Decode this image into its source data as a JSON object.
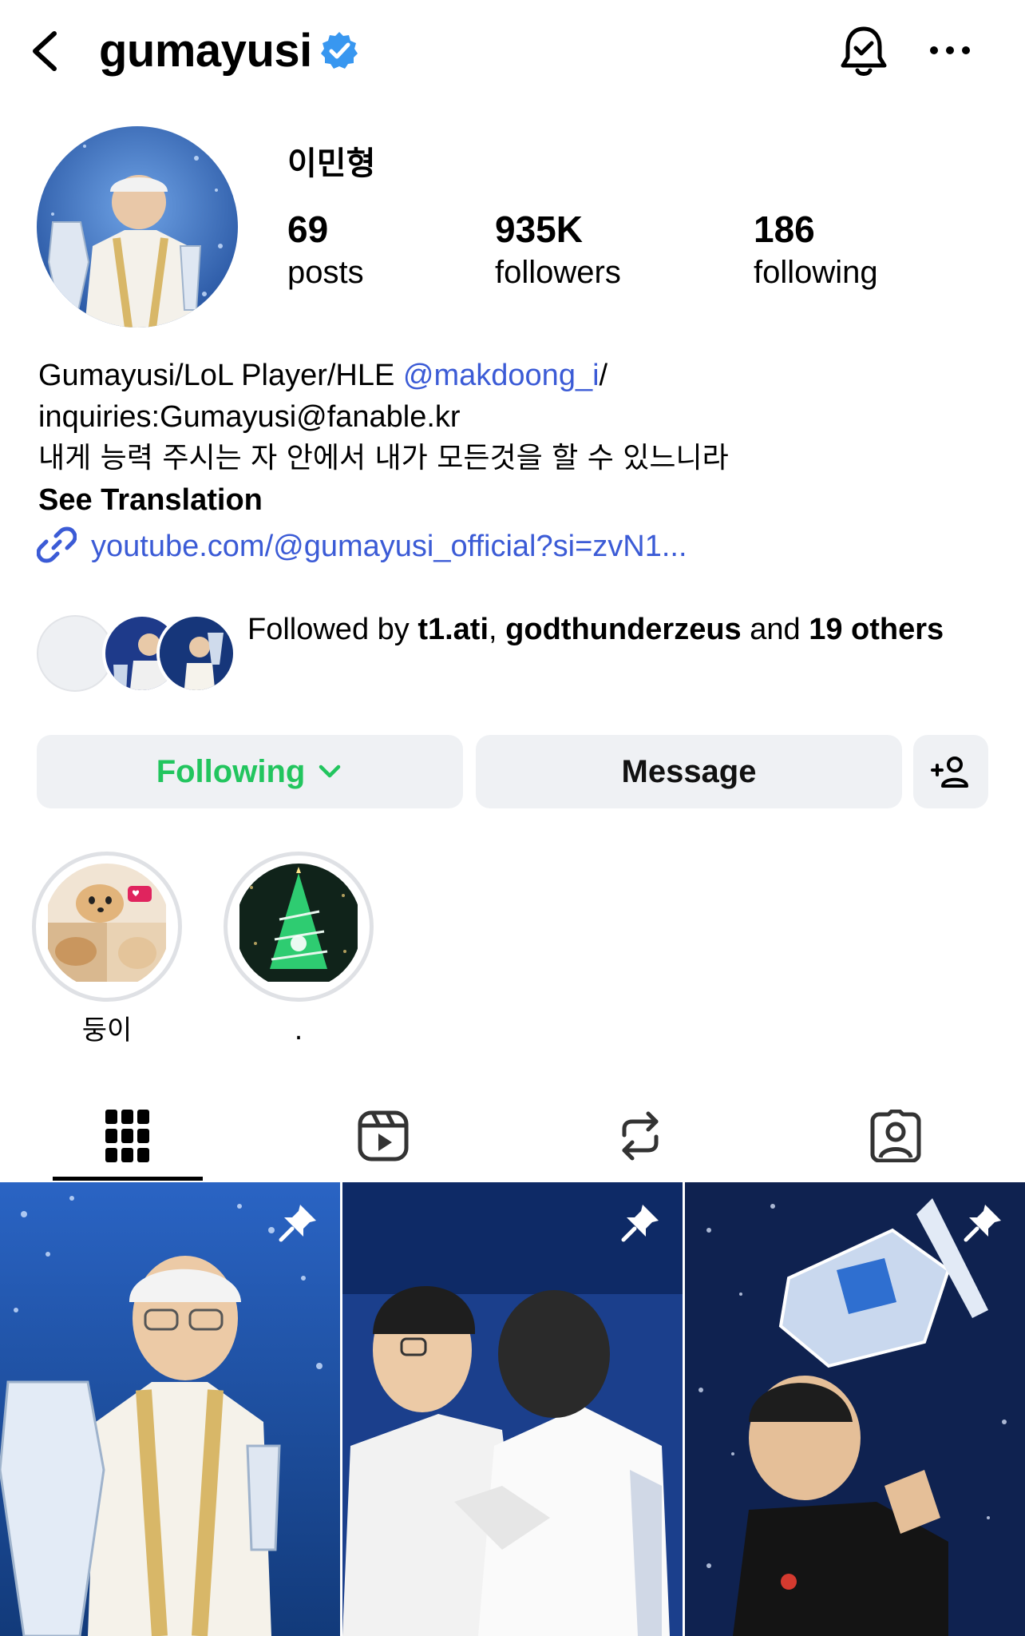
{
  "header": {
    "username": "gumayusi",
    "icons": [
      "back-arrow-icon",
      "verified-badge-icon",
      "notification-bell-icon",
      "more-options-icon"
    ]
  },
  "profile": {
    "display_name": "이민형",
    "stats": [
      {
        "value": "69",
        "label": "posts"
      },
      {
        "value": "935K",
        "label": "followers"
      },
      {
        "value": "186",
        "label": "following"
      }
    ]
  },
  "bio": {
    "line1_text": "Gumayusi/LoL Player/HLE ",
    "line1_mention": "@makdoong_i",
    "line1_tail": "/",
    "line2": "inquiries:Gumayusi@fanable.kr",
    "line3": "내게 능력 주시는 자 안에서 내가 모든것을 할 수 있느니라",
    "translate": "See Translation",
    "link": "youtube.com/@gumayusi_official?si=zvN1..."
  },
  "followed_by": {
    "prefix": "Followed by ",
    "user1": "t1.ati",
    "sep": ", ",
    "user2": "godthunderzeus",
    "mid": " and ",
    "count_word": "19 others"
  },
  "actions": {
    "following_label": "Following",
    "message_label": "Message"
  },
  "highlights": [
    {
      "label": "둥이"
    },
    {
      "label": "."
    }
  ],
  "tabs": [
    "grid-tab",
    "reels-tab",
    "reposts-tab",
    "tagged-tab"
  ],
  "colors": {
    "link_blue": "#3b5bd6",
    "following_green": "#22c55e",
    "button_bg": "#eff1f4",
    "verified_blue": "#3897f0"
  }
}
